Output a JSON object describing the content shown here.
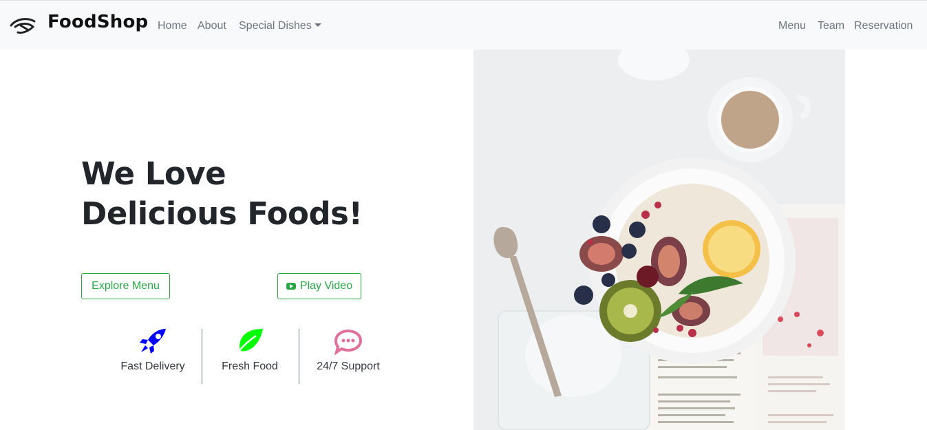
{
  "navbar": {
    "brand": "FoodShop",
    "left_links": [
      "Home",
      "About",
      "Special Dishes"
    ],
    "right_links": [
      "Menu",
      "Team",
      "Reservation"
    ]
  },
  "hero": {
    "title_line1": "We Love",
    "title_line2": "Delicious Foods!",
    "explore_button": "Explore Menu",
    "play_button": "Play Video"
  },
  "features": [
    {
      "label": "Fast Delivery",
      "icon": "rocket-icon",
      "color": "#0000ff"
    },
    {
      "label": "Fresh Food",
      "icon": "leaf-icon",
      "color": "#00ff00"
    },
    {
      "label": "24/7 Support",
      "icon": "chat-bubble-icon",
      "color": "#e0709a"
    }
  ],
  "colors": {
    "accent": "#28a745",
    "navbar_bg": "#f8f9fa",
    "nav_text": "#6c757d"
  },
  "image": {
    "semantic": "breakfast-bowl-photo"
  }
}
